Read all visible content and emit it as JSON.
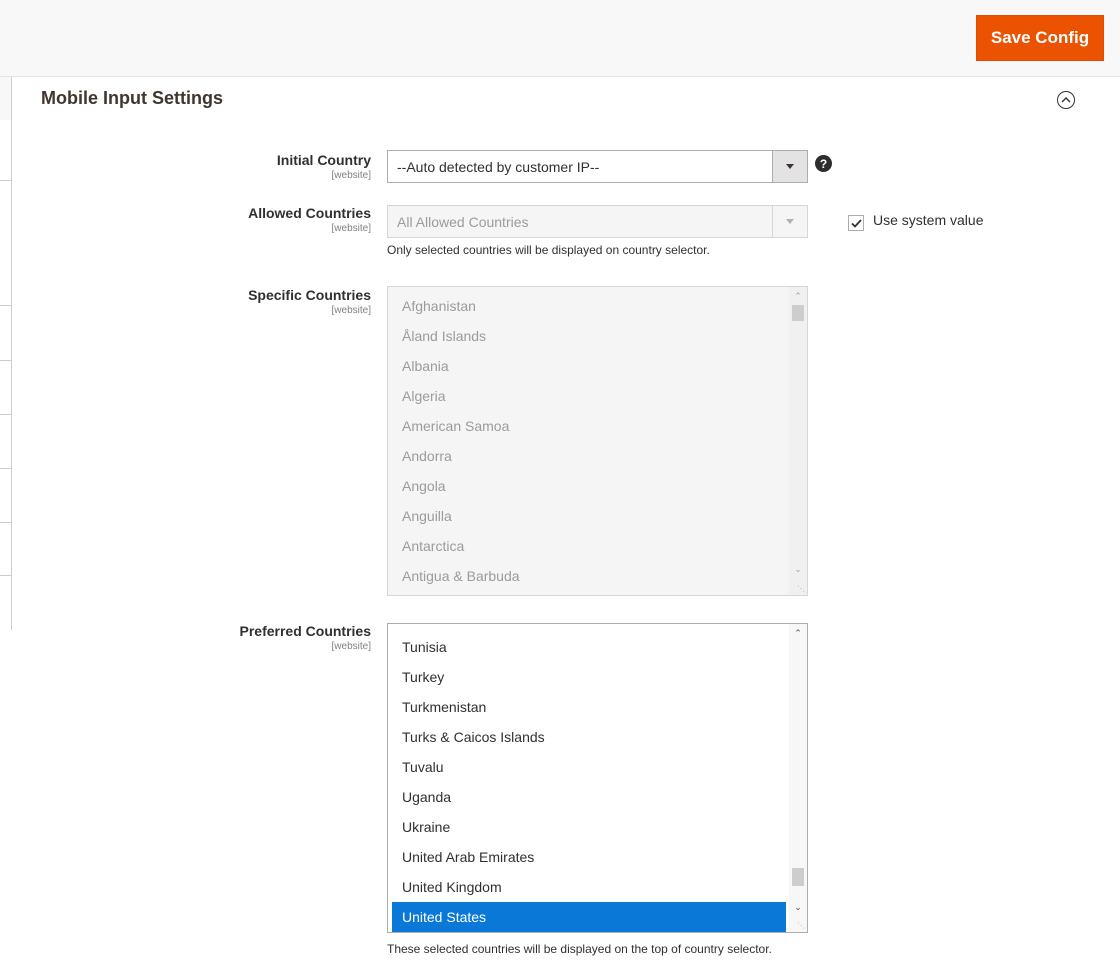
{
  "header": {
    "save_label": "Save Config"
  },
  "section": {
    "title": "Mobile Input Settings"
  },
  "fields": {
    "initial_country": {
      "label": "Initial Country",
      "scope": "[website]",
      "value": "--Auto detected by customer IP--",
      "help": "?"
    },
    "allowed_countries": {
      "label": "Allowed Countries",
      "scope": "[website]",
      "value": "All Allowed Countries",
      "note": "Only selected countries will be displayed on country selector.",
      "use_system_value_label": "Use system value",
      "use_system_value_checked": true
    },
    "specific_countries": {
      "label": "Specific Countries",
      "scope": "[website]",
      "options": [
        "Afghanistan",
        "Åland Islands",
        "Albania",
        "Algeria",
        "American Samoa",
        "Andorra",
        "Angola",
        "Anguilla",
        "Antarctica",
        "Antigua & Barbuda"
      ]
    },
    "preferred_countries": {
      "label": "Preferred Countries",
      "scope": "[website]",
      "options": [
        "Tunisia",
        "Turkey",
        "Turkmenistan",
        "Turks & Caicos Islands",
        "Tuvalu",
        "Uganda",
        "Ukraine",
        "United Arab Emirates",
        "United Kingdom",
        "United States"
      ],
      "selected": "United States",
      "note": "These selected countries will be displayed on the top of country selector."
    }
  },
  "icons": {
    "collapse": "chevron-up-circle-icon",
    "help": "question-mark-icon",
    "dropdown": "arrow-down-icon",
    "checkmark": "checkmark-icon"
  },
  "colors": {
    "accent": "#eb5202",
    "selection": "#0a78d6",
    "disabled_bg": "#f5f5f5"
  }
}
